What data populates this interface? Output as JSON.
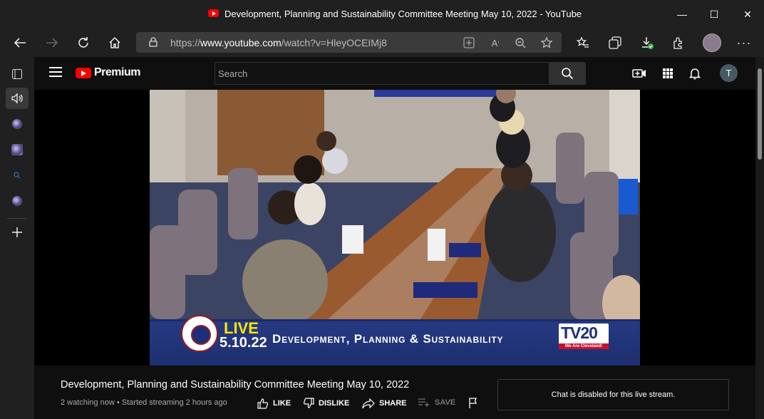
{
  "window": {
    "title": "Development, Planning and Sustainability Committee Meeting May 10, 2022 - YouTube",
    "controls": {
      "minimize": "—",
      "maximize": "☐",
      "close": "✕"
    }
  },
  "browser": {
    "url_prefix": "https://",
    "url_host": "www.youtube.com",
    "url_path": "/watch?v=HleyOCEIMj8"
  },
  "youtube": {
    "brand": "Premium",
    "search_placeholder": "Search",
    "user_initial": "T"
  },
  "video": {
    "banner": {
      "live": "LIVE",
      "date": "5.10.22",
      "committee": "Development, Planning & Sustainability",
      "station": "TV20",
      "station_tag": "We Are Cleveland!"
    },
    "title": "Development, Planning and Sustainability Committee Meeting May 10, 2022",
    "meta": "2 watching now • Started streaming 2 hours ago",
    "actions": {
      "like": "LIKE",
      "dislike": "DISLIKE",
      "share": "SHARE",
      "save": "SAVE"
    },
    "chat_notice": "Chat is disabled for this live stream."
  },
  "colors": {
    "youtube_red": "#ff0000",
    "banner_blue": "#263a82",
    "live_yellow": "#ffe600"
  }
}
